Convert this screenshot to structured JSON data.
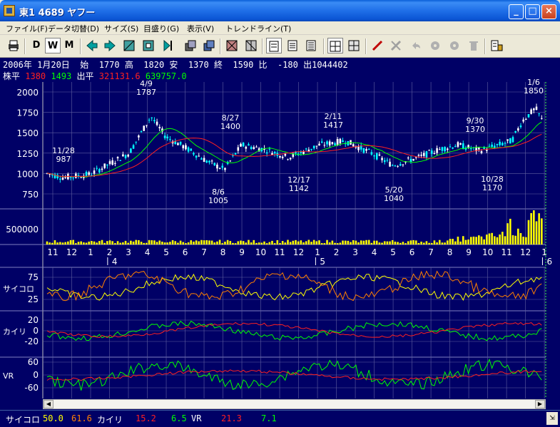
{
  "window": {
    "title": "東1 4689 ヤフー"
  },
  "menu": [
    "ファイル(F)",
    "データ切替(D)",
    "サイズ(S)",
    "目盛り(G)",
    "表示(V)",
    "トレンドライン(T)"
  ],
  "toolbar": {
    "d_label": "D",
    "w_label": "W",
    "m_label": "M"
  },
  "info": {
    "line1": "2006年 1月20日  始  1770 高  1820 安  1370 終  1590 比  -180 出1044402",
    "line2_label": "株平",
    "line2_v1": "1380",
    "line2_v2": "1493",
    "line2_label2": "出平",
    "line2_v3": "321131.6",
    "line2_v4": "639757.0"
  },
  "price_axis": [
    "2000",
    "1750",
    "1500",
    "1250",
    "1000",
    "750"
  ],
  "volume_axis": [
    "500000"
  ],
  "month_labels": [
    "11",
    "12",
    "1",
    "2",
    "3",
    "4",
    "5",
    "6",
    "7",
    "8",
    "9",
    "10",
    "11",
    "12",
    "1",
    "2",
    "3",
    "4",
    "5",
    "6",
    "7",
    "8",
    "9",
    "10",
    "11",
    "12",
    "1"
  ],
  "year_labels": [
    "4",
    "5",
    "6"
  ],
  "annotations": [
    {
      "date": "4/9",
      "value": "1787"
    },
    {
      "date": "11/28",
      "value": "987"
    },
    {
      "date": "8/27",
      "value": "1400"
    },
    {
      "date": "2/11",
      "value": "1417"
    },
    {
      "date": "9/30",
      "value": "1370"
    },
    {
      "date": "1/6",
      "value": "1850"
    },
    {
      "date": "8/6",
      "value": "1005"
    },
    {
      "date": "12/17",
      "value": "1142"
    },
    {
      "date": "5/20",
      "value": "1040"
    },
    {
      "date": "10/28",
      "value": "1170"
    }
  ],
  "indicators": {
    "saikoro_label": "サイコロ",
    "saikoro_ticks": [
      "75",
      "25"
    ],
    "kairi_label": "カイリ",
    "kairi_ticks": [
      "20",
      "0",
      "-20"
    ],
    "vr_label": "VR",
    "vr_ticks": [
      "60",
      "0",
      "-60"
    ]
  },
  "status": {
    "saikoro_label": "サイコロ",
    "saikoro_v1": "50.0",
    "saikoro_v2": "61.6",
    "kairi_label": "カイリ",
    "kairi_v1": "15.2",
    "kairi_v2": "6.5",
    "vr_label": "VR",
    "vr_v1": "21.3",
    "vr_v2": "7.1"
  },
  "colors": {
    "background": "#000066",
    "grid": "#6060a0",
    "candle_up": "#ffffff",
    "candle_down": "#00ffff",
    "ma_short": "#00ff00",
    "ma_long": "#ff2020",
    "volume": "#ffff00",
    "saikoro_line": "#ffff00",
    "saikoro_line2": "#ff8000"
  }
}
